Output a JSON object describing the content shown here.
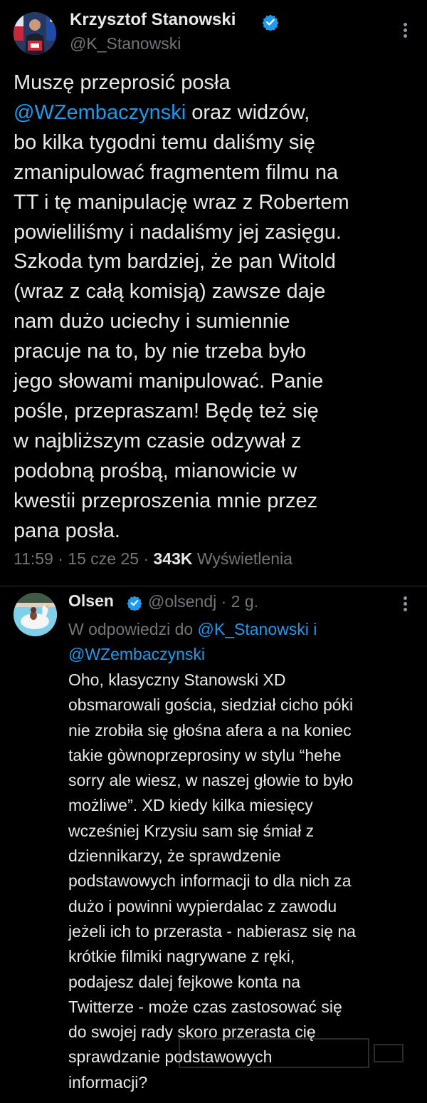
{
  "tweet": {
    "author_name": "Krzysztof Stanowski",
    "author_handle": "@K_Stanowski",
    "text_lines": [
      [
        {
          "t": "Muszę przeprosić posła",
          "c": "text"
        }
      ],
      [
        {
          "t": "@WZembaczynski",
          "c": "mention"
        },
        {
          "t": " oraz widzów,",
          "c": "text"
        }
      ],
      [
        {
          "t": "bo kilka tygodni temu daliśmy się",
          "c": "text"
        }
      ],
      [
        {
          "t": "zmanipulować fragmentem filmu na",
          "c": "text"
        }
      ],
      [
        {
          "t": "TT i tę manipulację wraz z Robertem",
          "c": "text"
        }
      ],
      [
        {
          "t": "powieliliśmy i nadaliśmy jej zasięgu.",
          "c": "text"
        }
      ],
      [
        {
          "t": "Szkoda tym bardziej, że pan Witold",
          "c": "text"
        }
      ],
      [
        {
          "t": "(wraz z całą komisją) zawsze daje",
          "c": "text"
        }
      ],
      [
        {
          "t": "nam dużo uciechy i sumiennie",
          "c": "text"
        }
      ],
      [
        {
          "t": "pracuje na to, by nie trzeba było",
          "c": "text"
        }
      ],
      [
        {
          "t": "jego słowami manipulować. Panie",
          "c": "text"
        }
      ],
      [
        {
          "t": "pośle, przepraszam! Będę też się",
          "c": "text"
        }
      ],
      [
        {
          "t": "w najbliższym czasie odzywał z",
          "c": "text"
        }
      ],
      [
        {
          "t": "podobną prośbą, mianowicie w",
          "c": "text"
        }
      ],
      [
        {
          "t": "kwestii przeproszenia mnie przez",
          "c": "text"
        }
      ],
      [
        {
          "t": "pana posła.",
          "c": "text"
        }
      ]
    ],
    "time": "11:59",
    "sep": " · ",
    "date": "15 cze 25",
    "views_count": "343K",
    "views_label": "Wyświetlenia"
  },
  "reply": {
    "author_name": "Olsen",
    "handle_time": "@olsendj · 2 g.",
    "replying_lines": [
      [
        {
          "t": "W odpowiedzi do ",
          "c": "muted"
        },
        {
          "t": "@K_Stanowski",
          "c": "mention"
        },
        {
          "t": " i",
          "c": "mention"
        }
      ],
      [
        {
          "t": "@WZembaczynski",
          "c": "mention"
        }
      ]
    ],
    "text_lines": [
      "Oho, klasyczny Stanowski XD",
      "obsmarowali gościa, siedział cicho póki",
      "nie zrobiła się głośna afera a na koniec",
      "takie gòwnoprzeprosiny w stylu “hehe",
      "sorry ale wiesz, w naszej głowie to było",
      "możliwe”. XD kiedy kilka miesięcy",
      "wcześniej Krzysiu sam się śmiał z",
      "dziennikarzy, że sprawdzenie",
      "podstawowych informacji to dla nich za",
      "dużo i powinni wypierdalac z zawodu",
      "jeżeli ich to przerasta - nabierasz się na",
      "krótkie filmiki nagrywane z ręki,",
      "podajesz dalej fejkowe konta na",
      "Twitterze - może czas zastosować się",
      "do swojej rady skoro przerasta cię",
      "sprawdzanie podstawowych",
      "informacji?"
    ]
  },
  "icons": {
    "verified": "verified-badge-icon",
    "more": "more-options-icon"
  },
  "colors": {
    "background": "#000000",
    "text": "#e7e9ea",
    "muted": "#71767b",
    "accent": "#1d9bf0"
  }
}
